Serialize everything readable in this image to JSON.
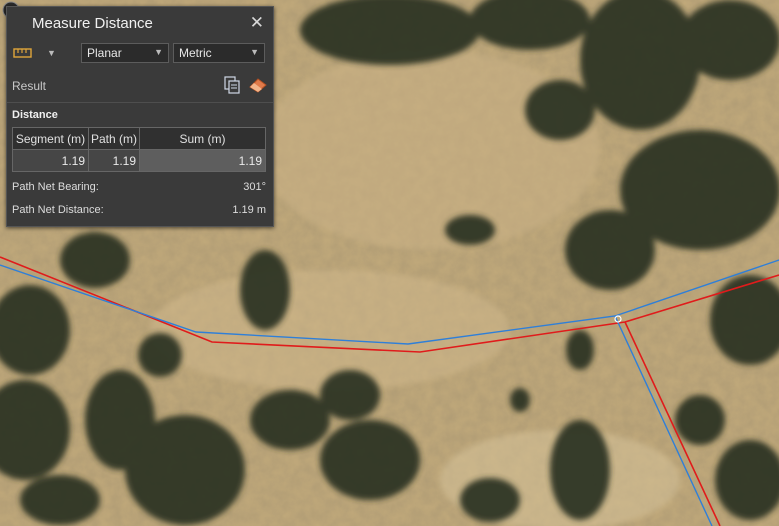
{
  "panel": {
    "title": "Measure Distance",
    "mode_dropdown": "Planar",
    "units_dropdown": "Metric",
    "result_label": "Result",
    "distance_label": "Distance",
    "table": {
      "headers": [
        "Segment (m)",
        "Path (m)",
        "Sum (m)"
      ],
      "row": [
        "1.19",
        "1.19",
        "1.19"
      ]
    },
    "bearing_label": "Path Net Bearing:",
    "bearing_value": "301°",
    "net_distance_label": "Path Net Distance:",
    "net_distance_value": "1.19 m"
  },
  "colors": {
    "panel_bg": "#3a3a3a",
    "measure_line": "#2f7fd8",
    "boundary_line": "#e01b1b",
    "terrain": "#c4ad7e",
    "vegetation": "#2b3623"
  },
  "icons": [
    "ruler-icon",
    "chevron-down-icon",
    "close-icon",
    "copy-icon",
    "eraser-icon",
    "pin-icon"
  ]
}
